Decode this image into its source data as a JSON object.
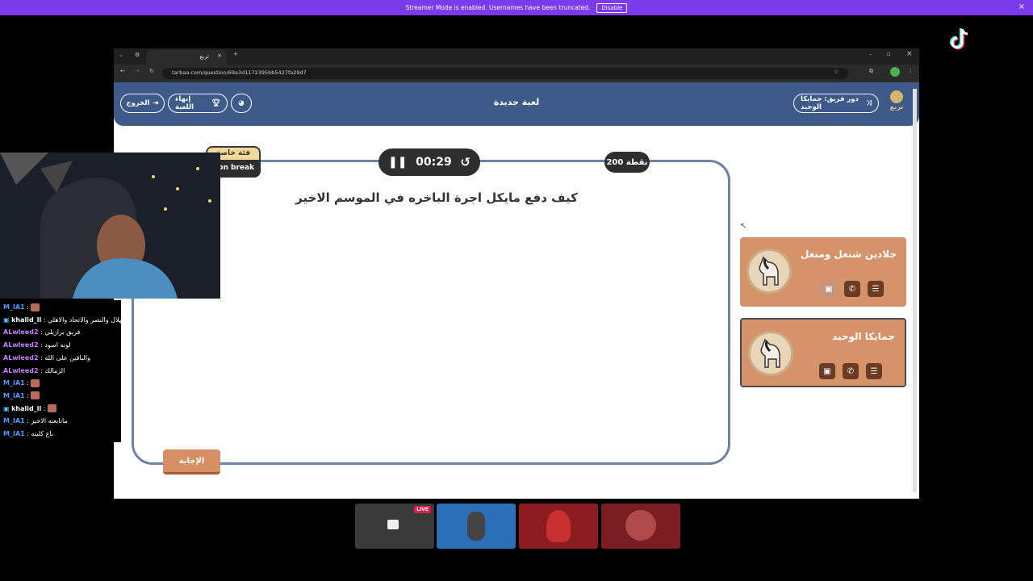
{
  "banner": {
    "text": "Streamer Mode is enabled. Usernames have been truncated.",
    "disable_label": "Disable",
    "close": "×"
  },
  "browser": {
    "tab_title": "تربع",
    "url": "tarbaa.com/question/69a3d1172395bb5427fa29d7"
  },
  "app": {
    "turn_label": "دور فريق: جمايكا الوحيد",
    "title": "لعبة جديدة",
    "exit_label": "الخروج",
    "end_game_label": "إنهاء اللعبة",
    "logo_text": "تربع"
  },
  "question": {
    "text": "كيف دفع مايكل اجرة الباخره في الموسم الاخير",
    "timer": "00:29",
    "points": "200 نقطة",
    "category": "فئة خاصة",
    "subcategory": "son break",
    "answer_label": "الإجابة"
  },
  "teams": [
    {
      "name": "جلادين شنغل ومنغل",
      "active": false
    },
    {
      "name": "جمايكا الوحيد",
      "active": true
    }
  ],
  "chat": [
    {
      "user": "M_IA1",
      "text": "",
      "color": "#4a9eff",
      "emote": true
    },
    {
      "user": "khalid_ll",
      "text": "الهلال والنصر والاتحاد والاهلي",
      "color": "#ffffff",
      "emote": false,
      "badges": true
    },
    {
      "user": "ALwleed2",
      "text": "فريق برازيلي",
      "color": "#c77dff",
      "emote": false
    },
    {
      "user": "ALwleed2",
      "text": "لونه اسود",
      "color": "#c77dff",
      "emote": false
    },
    {
      "user": "ALwleed2",
      "text": "والباقين على الله",
      "color": "#c77dff",
      "emote": false
    },
    {
      "user": "ALwleed2",
      "text": "الزمالك",
      "color": "#c77dff",
      "emote": false
    },
    {
      "user": "M_IA1",
      "text": "",
      "color": "#4a9eff",
      "emote": true
    },
    {
      "user": "M_IA1",
      "text": "",
      "color": "#4a9eff",
      "emote": true
    },
    {
      "user": "khalid_ll",
      "text": "",
      "color": "#ffffff",
      "emote": true,
      "badges": true
    },
    {
      "user": "M_IA1",
      "text": "ماتابعته الاخير",
      "color": "#4a9eff",
      "emote": false
    },
    {
      "user": "M_IA1",
      "text": "باع كليته",
      "color": "#4a9eff",
      "emote": false
    }
  ],
  "live_badge": "LIVE",
  "colors": {
    "banner": "#7c3aed",
    "header": "#3d5a89",
    "team_card": "#d6936a",
    "answer": "#d68e63"
  }
}
